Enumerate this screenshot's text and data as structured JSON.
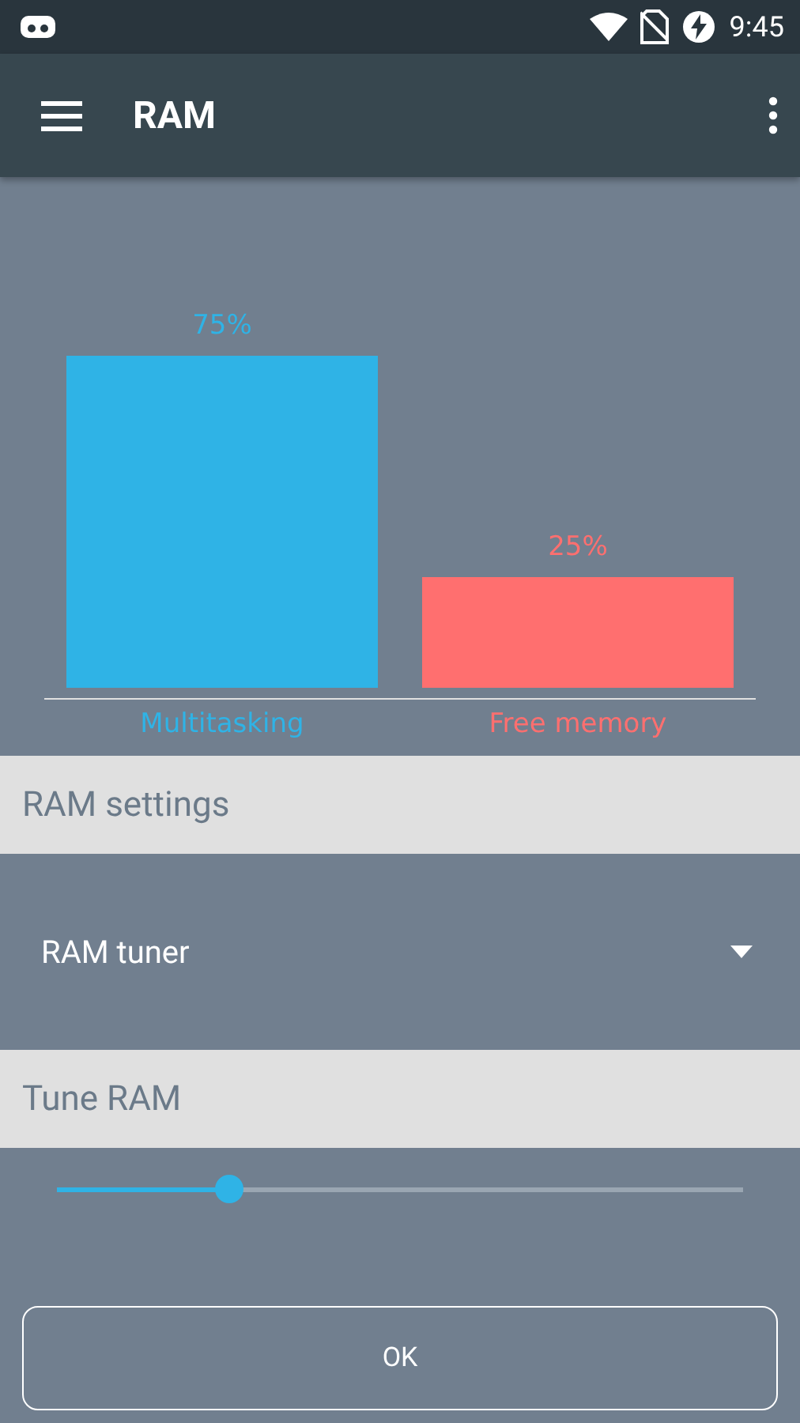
{
  "status_bar": {
    "time": "9:45"
  },
  "toolbar": {
    "title": "RAM"
  },
  "chart_data": {
    "type": "bar",
    "categories": [
      "Multitasking",
      "Free memory"
    ],
    "data_labels": true,
    "series": [
      {
        "values": [
          75,
          25
        ],
        "value_labels": [
          "75%",
          "25%"
        ],
        "colors": [
          "#2fb3e6",
          "#ff6f6f"
        ]
      }
    ]
  },
  "sections": [
    {
      "kind": "header",
      "label": "RAM settings"
    },
    {
      "kind": "dropdown",
      "value": "RAM tuner"
    },
    {
      "kind": "header",
      "label": "Tune RAM"
    },
    {
      "kind": "slider",
      "level": 0.25
    }
  ],
  "button": {
    "label": "OK"
  }
}
